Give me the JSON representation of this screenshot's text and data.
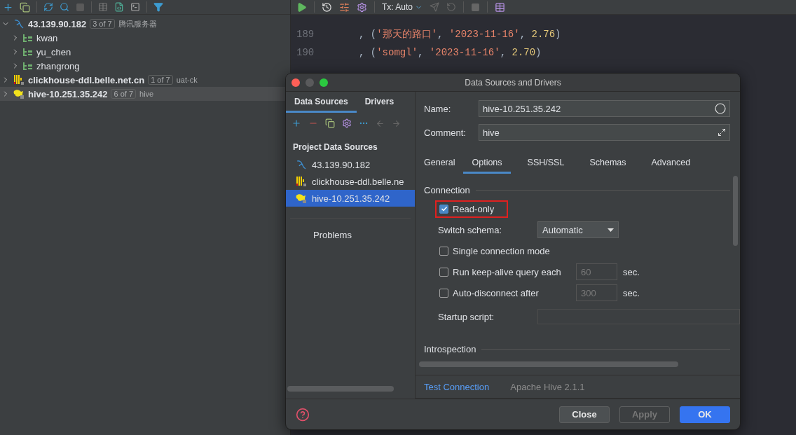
{
  "tree": [
    {
      "label": "43.139.90.182",
      "badge": "3 of 7",
      "comment": "腾讯服务器",
      "kind": "mysql",
      "expanded": true,
      "selected": false,
      "children": [
        {
          "label": "kwan",
          "expanded": false
        },
        {
          "label": "yu_chen",
          "expanded": false
        },
        {
          "label": "zhangrong",
          "expanded": false
        }
      ]
    },
    {
      "label": "clickhouse-ddl.belle.net.cn",
      "badge": "1 of 7",
      "comment": "uat-ck",
      "kind": "clickhouse",
      "expanded": false,
      "selected": false
    },
    {
      "label": "hive-10.251.35.242",
      "badge": "6 of 7",
      "comment": "hive",
      "kind": "hive",
      "expanded": false,
      "selected": true
    }
  ],
  "editor": {
    "tx_mode": "Tx: Auto",
    "lines": [
      {
        "number": "189",
        "tokens": [
          {
            "kind": "punct",
            "text": ", ("
          },
          {
            "kind": "string",
            "text": "'那天的路口'"
          },
          {
            "kind": "punct",
            "text": ", "
          },
          {
            "kind": "string",
            "text": "'2023-11-16'"
          },
          {
            "kind": "punct",
            "text": ", "
          },
          {
            "kind": "number",
            "text": "2.76"
          },
          {
            "kind": "punct",
            "text": ")"
          }
        ]
      },
      {
        "number": "190",
        "tokens": [
          {
            "kind": "punct",
            "text": ", ("
          },
          {
            "kind": "string",
            "text": "'somgl'"
          },
          {
            "kind": "punct",
            "text": ", "
          },
          {
            "kind": "string",
            "text": "'2023-11-16'"
          },
          {
            "kind": "punct",
            "text": ", "
          },
          {
            "kind": "number",
            "text": "2.70"
          },
          {
            "kind": "punct",
            "text": ")"
          }
        ]
      }
    ]
  },
  "dialog": {
    "title": "Data Sources and Drivers",
    "side_tabs": [
      {
        "label": "Data Sources",
        "selected": true
      },
      {
        "label": "Drivers",
        "selected": false
      }
    ],
    "section_title": "Project Data Sources",
    "sources": [
      {
        "label": "43.139.90.182",
        "kind": "mysql",
        "selected": false
      },
      {
        "label": "clickhouse-ddl.belle.ne",
        "kind": "clickhouse",
        "selected": false
      },
      {
        "label": "hive-10.251.35.242",
        "kind": "hive",
        "selected": true
      }
    ],
    "problems": "Problems",
    "name_label": "Name:",
    "name_value": "hive-10.251.35.242",
    "comment_label": "Comment:",
    "comment_value": "hive",
    "tabs": [
      {
        "label": "General",
        "selected": false
      },
      {
        "label": "Options",
        "selected": true
      },
      {
        "label": "SSH/SSL",
        "selected": false
      },
      {
        "label": "Schemas",
        "selected": false
      },
      {
        "label": "Advanced",
        "selected": false
      }
    ],
    "connection_title": "Connection",
    "read_only": {
      "label": "Read-only",
      "checked": true,
      "highlighted": true
    },
    "switch_schema": {
      "label": "Switch schema:",
      "value": "Automatic"
    },
    "options": [
      {
        "label": "Single connection mode",
        "checked": false
      },
      {
        "label": "Run keep-alive query each",
        "checked": false,
        "placeholder": "60",
        "unit": "sec."
      },
      {
        "label": "Auto-disconnect after",
        "checked": false,
        "placeholder": "300",
        "unit": "sec."
      }
    ],
    "startup_label": "Startup script:",
    "introspection_title": "Introspection",
    "test_connection": "Test Connection",
    "driver": "Apache Hive 2.1.1",
    "buttons": [
      {
        "label": "Close",
        "kind": "default",
        "disabled": false
      },
      {
        "label": "Apply",
        "kind": "default",
        "disabled": true
      },
      {
        "label": "OK",
        "kind": "primary",
        "disabled": false
      }
    ]
  }
}
